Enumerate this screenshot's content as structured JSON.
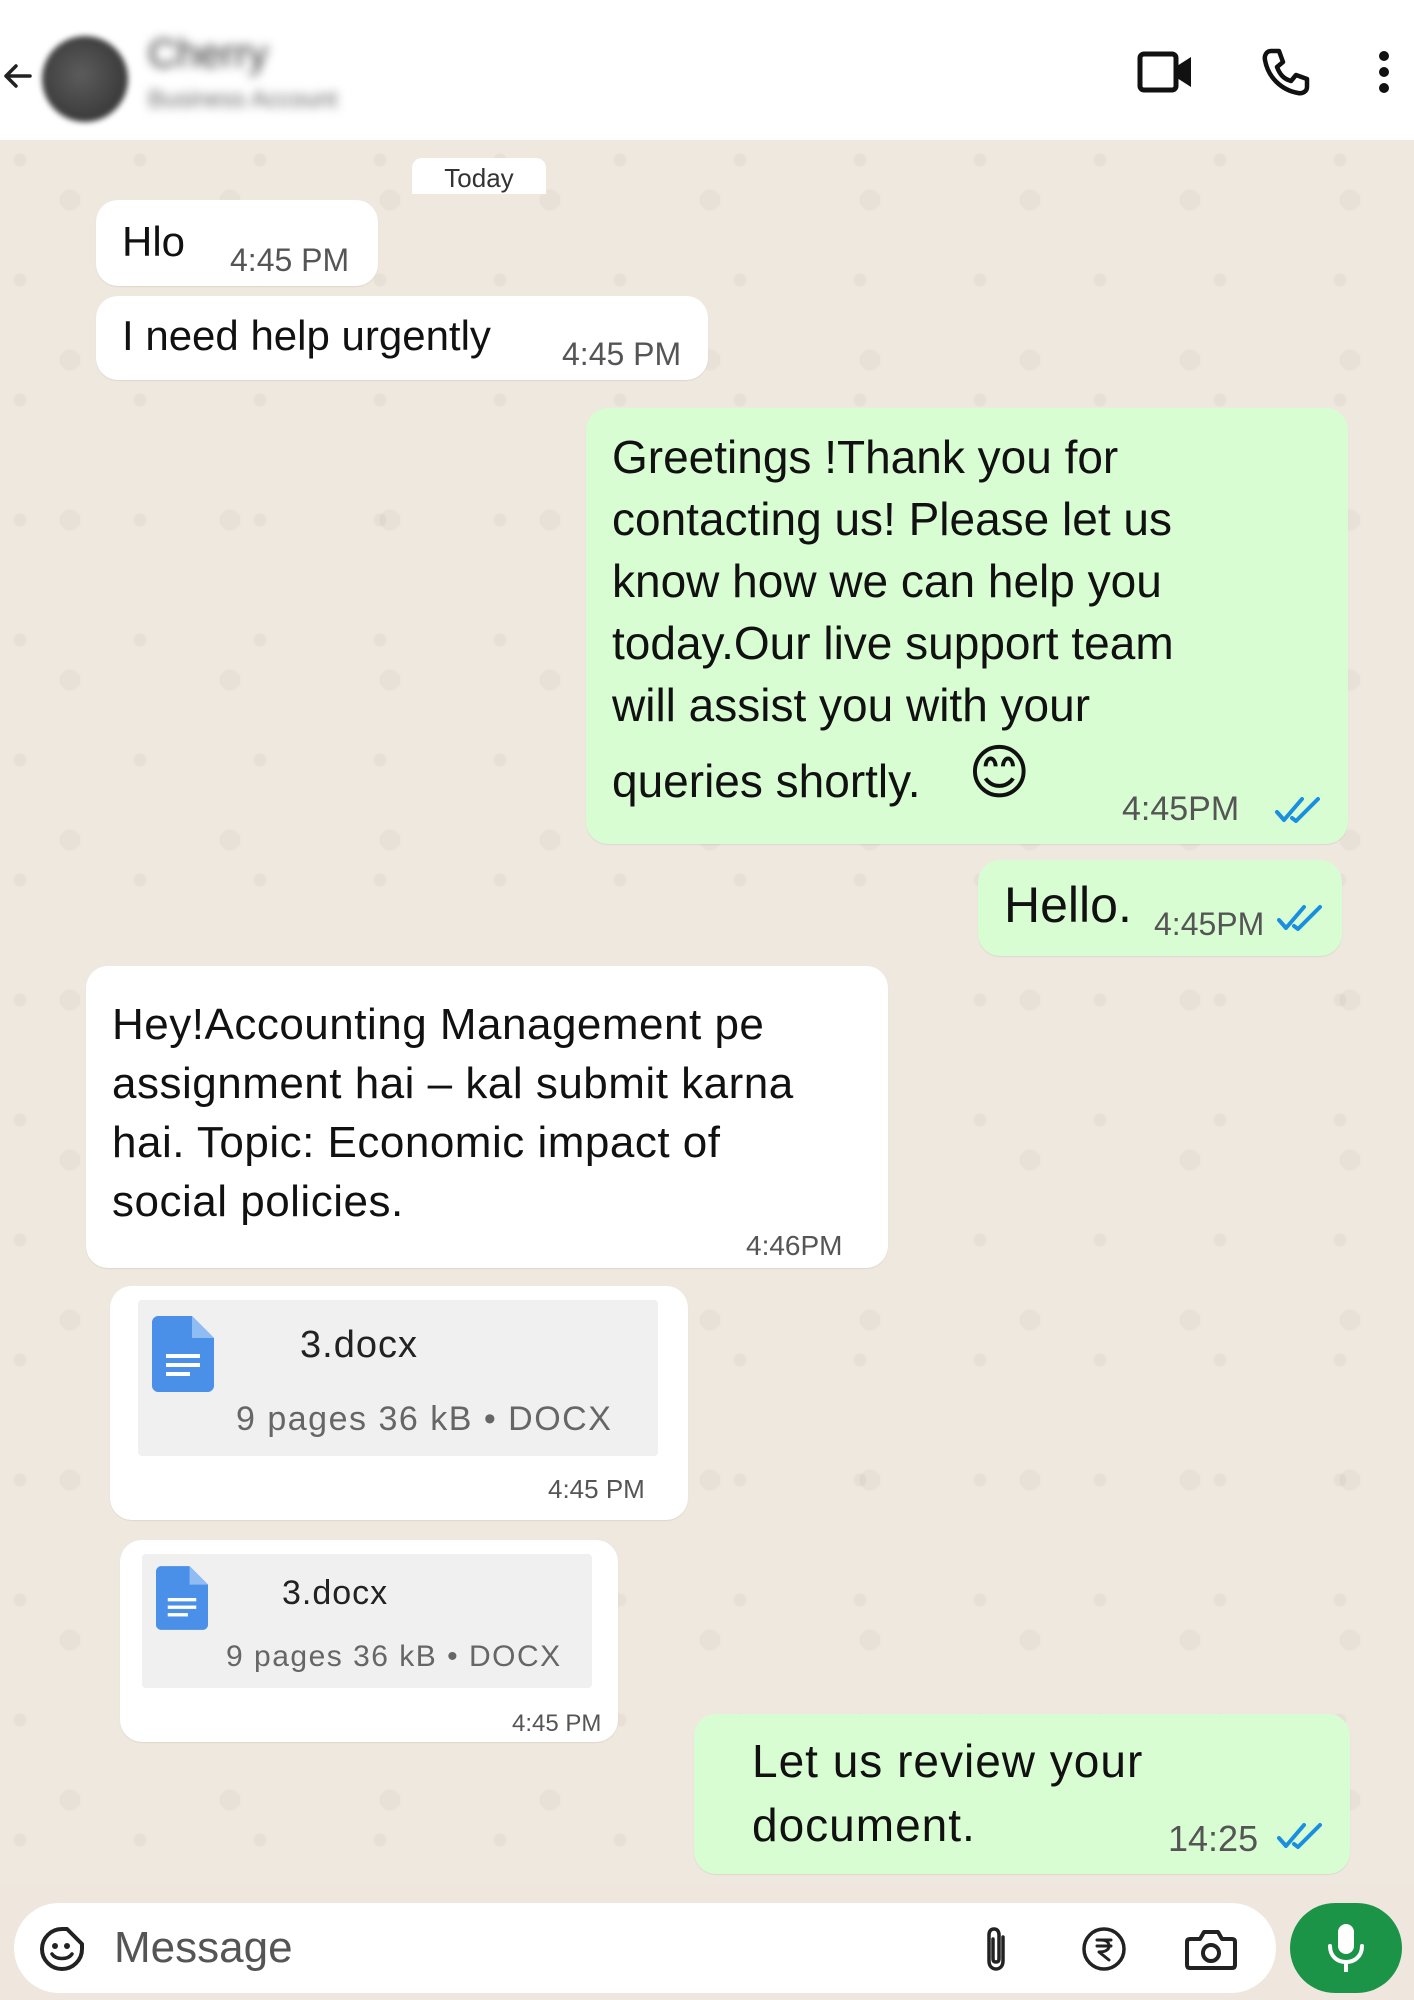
{
  "header": {
    "contact_name": "Cherry",
    "contact_subtitle": "Business Account",
    "icons": [
      "back-arrow-icon",
      "video-call-icon",
      "voice-call-icon",
      "more-options-icon"
    ]
  },
  "chat": {
    "date_chip": "Today",
    "messages": {
      "m1": {
        "text": "Hlo",
        "time": "4:45 PM"
      },
      "m2": {
        "text": "I need help urgently",
        "time": "4:45 PM"
      },
      "m3": {
        "lines": [
          "Greetings !Thank you for",
          "contacting us! Please let us",
          "know how we can help you",
          "today.Our live support team",
          "will assist you with your",
          "queries shortly."
        ],
        "emoji": "😊",
        "time": "4:45PM",
        "status": "read"
      },
      "m4": {
        "text": "Hello.",
        "time": "4:45PM",
        "status": "read"
      },
      "m5": {
        "lines": [
          "Hey!Accounting Management pe",
          "assignment hai – kal submit karna",
          "hai. Topic: Economic impact of",
          "social policies."
        ],
        "time": "4:46PM"
      },
      "m6": {
        "file_name": "3.docx",
        "meta": "9 pages 36 kB • DOCX",
        "time": "4:45 PM"
      },
      "m7": {
        "file_name": "3.docx",
        "meta": "9 pages 36 kB • DOCX",
        "time": "4:45 PM"
      },
      "m8": {
        "lines": [
          "Let us review your",
          "document."
        ],
        "time": "14:25",
        "status": "read"
      }
    }
  },
  "composer": {
    "placeholder": "Message",
    "icons": [
      "emoji-sticker-icon",
      "attach-icon",
      "rupee-payment-icon",
      "camera-icon",
      "microphone-icon"
    ]
  },
  "colors": {
    "incoming_bubble": "#ffffff",
    "outgoing_bubble": "#d9fdd3",
    "read_ticks": "#1a8fe0",
    "mic_button": "#1b9448",
    "chat_background": "#efe8de"
  }
}
